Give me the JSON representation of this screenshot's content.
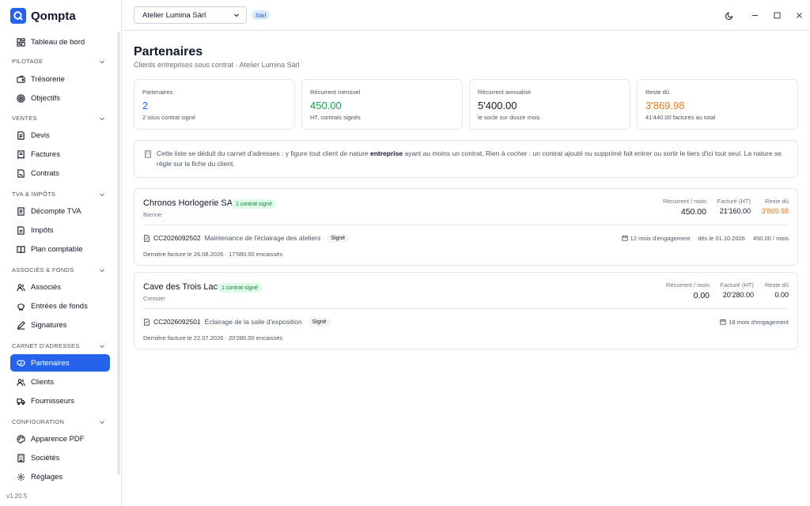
{
  "app": {
    "name": "Qompta",
    "version": "v1.20.5"
  },
  "sidebar": {
    "dashboard": "Tableau de bord",
    "sections": [
      {
        "label": "PILOTAGE",
        "items": [
          "Trésorerie",
          "Objectifs"
        ]
      },
      {
        "label": "VENTES",
        "items": [
          "Devis",
          "Factures",
          "Contrats"
        ]
      },
      {
        "label": "TVA & IMPÔTS",
        "items": [
          "Décompte TVA",
          "Impôts",
          "Plan comptable"
        ]
      },
      {
        "label": "ASSOCIÉS & FONDS",
        "items": [
          "Associés",
          "Entrées de fonds",
          "Signatures"
        ]
      },
      {
        "label": "CARNET D'ADRESSES",
        "items": [
          "Partenaires",
          "Clients",
          "Fournisseurs"
        ]
      },
      {
        "label": "CONFIGURATION",
        "items": [
          "Apparence PDF",
          "Sociétés",
          "Réglages"
        ]
      }
    ],
    "active": "Partenaires"
  },
  "topbar": {
    "company": "Atelier Lumina Sàrl",
    "company_type": "Sàrl"
  },
  "page": {
    "title": "Partenaires",
    "subtitle": "Clients entreprises sous contrat · Atelier Lumina Sàrl"
  },
  "stats": [
    {
      "label": "Partenaires",
      "value": "2",
      "sub": "2 sous contrat signé",
      "color": "#2563eb"
    },
    {
      "label": "Récurrent mensuel",
      "value": "450.00",
      "sub": "HT, contrats signés",
      "color": "#16a34a"
    },
    {
      "label": "Récurrent annualisé",
      "value": "5'400.00",
      "sub": "le socle sur douze mois",
      "color": "#111827"
    },
    {
      "label": "Reste dû",
      "value": "3'869.98",
      "sub": "41'440.00 facturés au total",
      "color": "#ea7a1c"
    }
  ],
  "info": {
    "before": "Cette liste se déduit du carnet d'adresses : y figure tout client de nature ",
    "bold": "entreprise",
    "after": " ayant au moins un contrat. Rien à cocher : un contrat ajouté ou supprimé fait entrer ou sortir le tiers d'ici tout seul. La nature se règle sur la fiche du client."
  },
  "metric_labels": {
    "recurring": "Récurrent / mois",
    "invoiced": "Facturé (HT)",
    "remaining": "Reste dû"
  },
  "partners": [
    {
      "name": "Chronos Horlogerie SA",
      "badge": "1 contrat signé",
      "city": "Bienne",
      "recurring": "450.00",
      "invoiced": "21'160.00",
      "remaining": "3'869.98",
      "contract": {
        "code": "CC2026092502",
        "description": "Maintenance de l'éclairage des ateliers",
        "status": "Signé",
        "engagement": "12 mois d'engagement",
        "start": "dès le 01.10.2026",
        "amount": "450.00 / mois"
      },
      "last_invoice": "Dernière facture le 26.08.2026 · 17'580.00 encaissés"
    },
    {
      "name": "Cave des Trois Lacs",
      "badge": "1 contrat signé",
      "city": "Cressier",
      "recurring": "0.00",
      "invoiced": "20'280.00",
      "remaining": "0.00",
      "contract": {
        "code": "CC2026092501",
        "description": "Éclairage de la salle d'exposition",
        "status": "Signé",
        "engagement": "18 mois d'engagement"
      },
      "last_invoice": "Dernière facture le 22.07.2026 · 20'280.00 encaissés"
    }
  ],
  "colors": {
    "accent": "#2563eb",
    "green": "#16a34a",
    "orange": "#ea7a1c"
  }
}
